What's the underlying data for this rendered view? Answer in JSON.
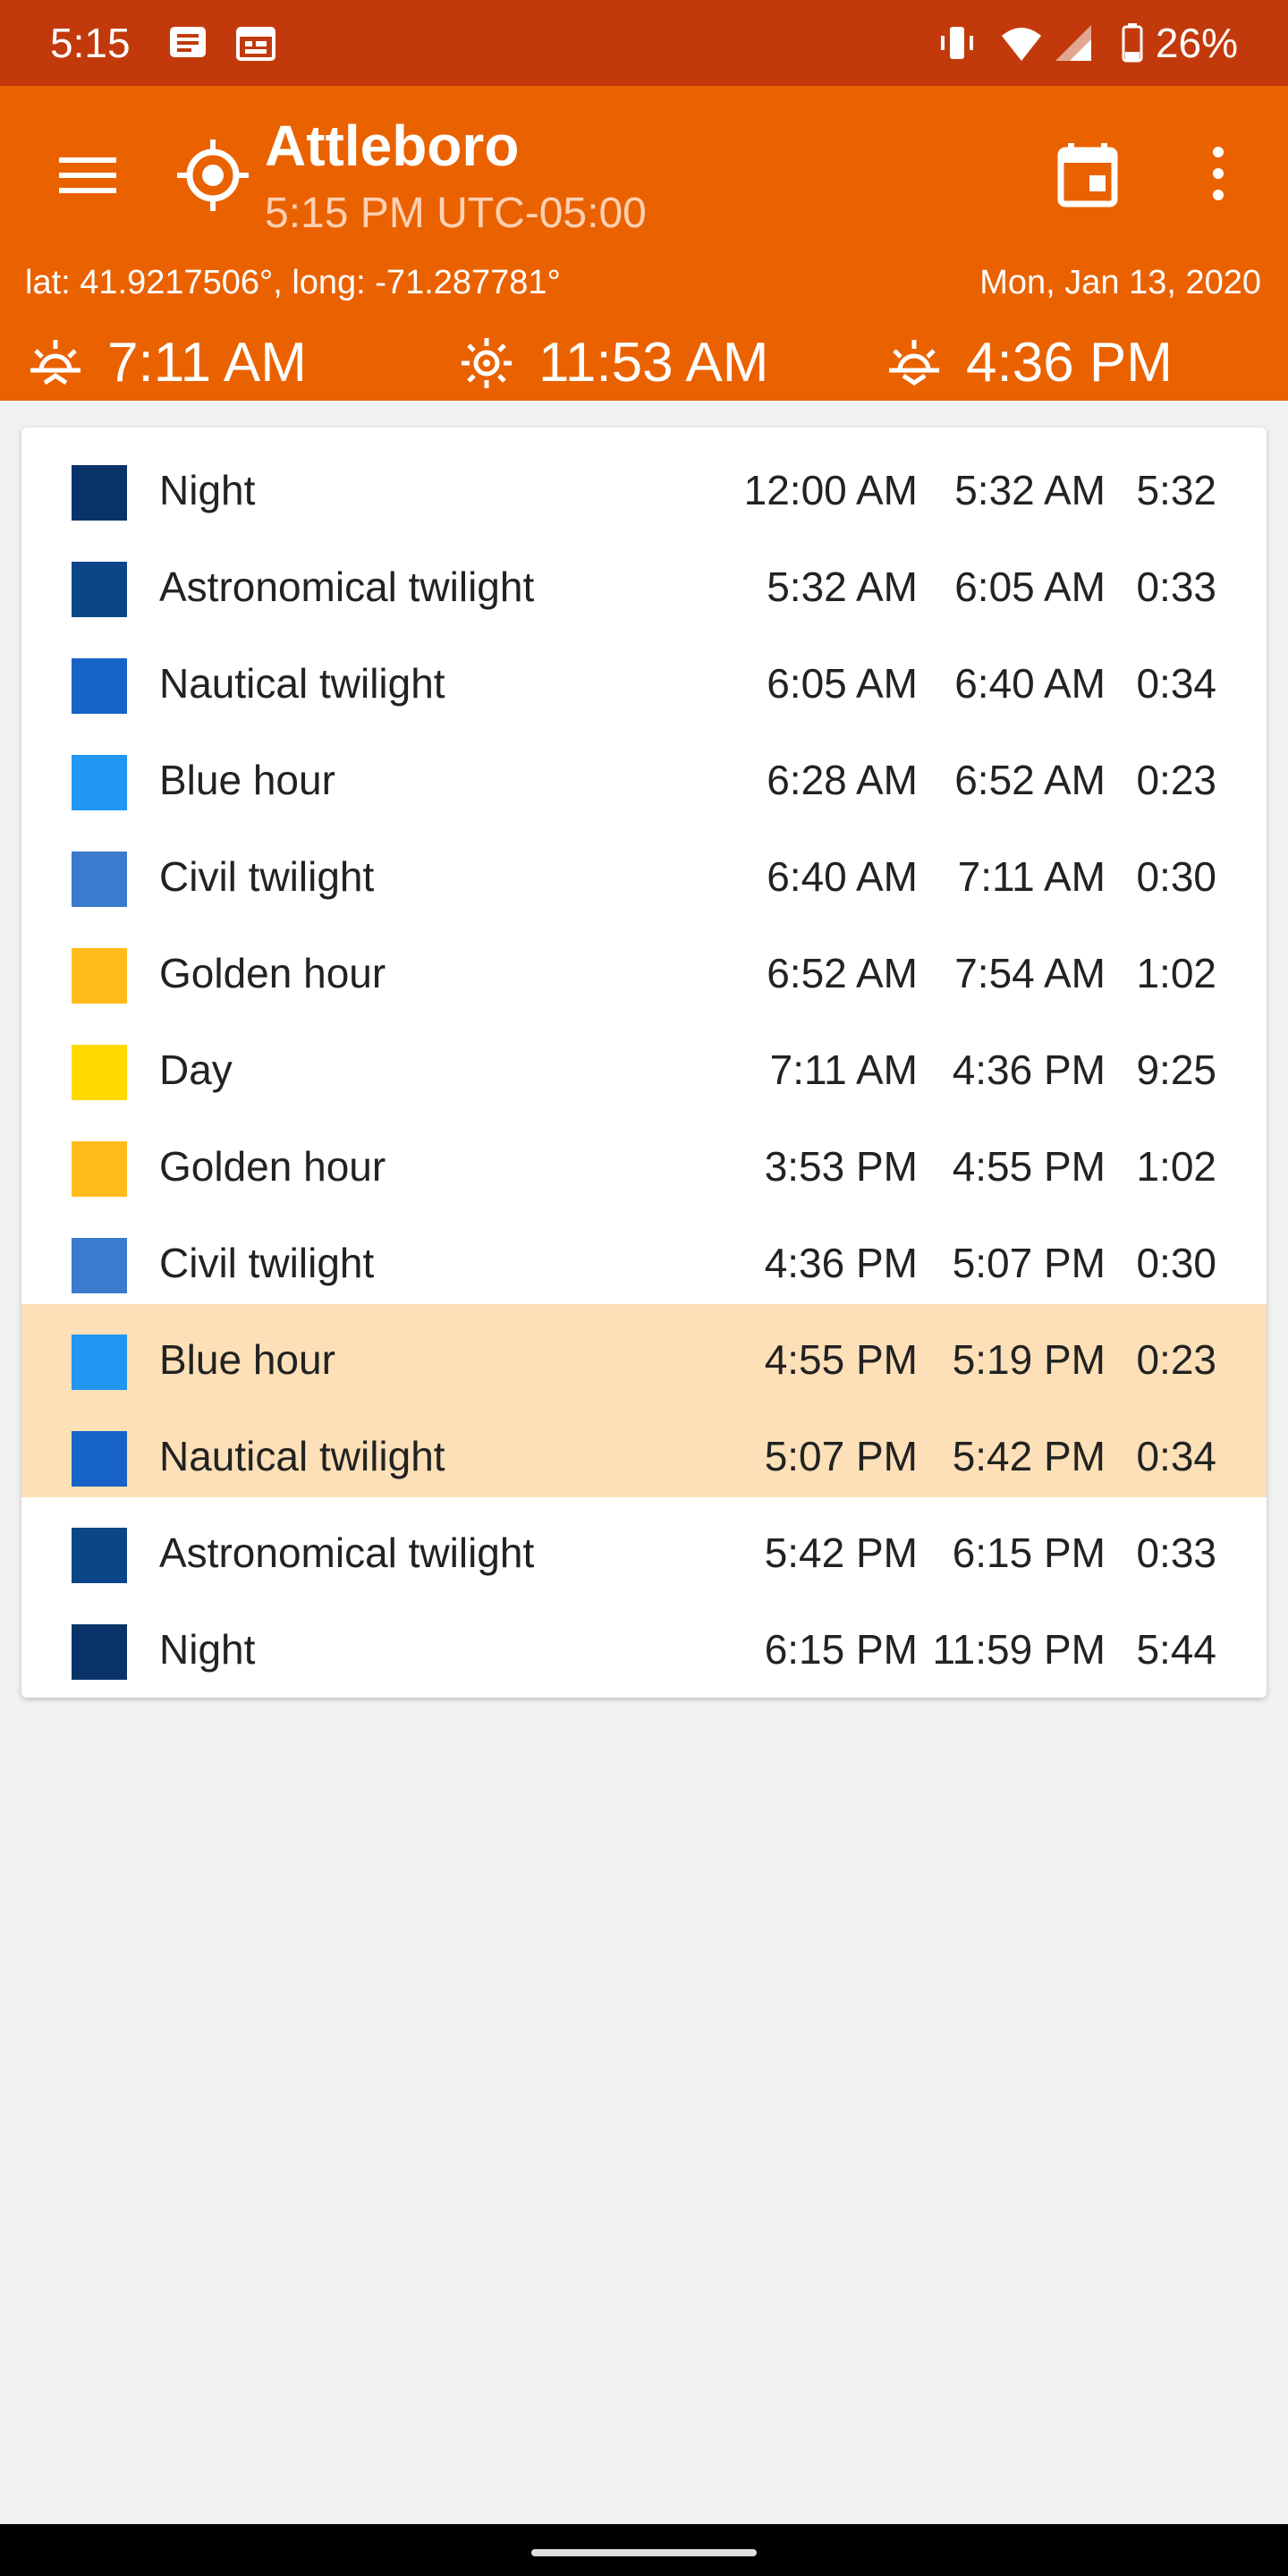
{
  "status_bar": {
    "time": "5:15",
    "battery": "26%",
    "left_icons": [
      "message-icon",
      "calendar-notification-icon"
    ],
    "right_icons": [
      "vibrate-icon",
      "wifi-icon",
      "signal-icon",
      "battery-icon"
    ]
  },
  "app_bar": {
    "title": "Attleboro",
    "subtitle": "5:15 PM UTC-05:00",
    "coordinates": "lat: 41.9217506°, long: -71.287781°",
    "date": "Mon, Jan 13, 2020",
    "sunrise": "7:11 AM",
    "noon": "11:53 AM",
    "sunset": "4:36 PM",
    "icons": [
      "menu-icon",
      "location-icon",
      "calendar-icon",
      "more-vert-icon"
    ]
  },
  "colors": {
    "status_bar": "#c23a0b",
    "app_bar": "#ea6200",
    "highlight": "#fde0b7",
    "night": "#0a3469",
    "astronomical": "#0d4688",
    "nautical": "#1763c7",
    "blue_hour": "#2196f3",
    "civil": "#3a7bcd",
    "golden": "#ffbb1c",
    "day": "#ffd900"
  },
  "rows": [
    {
      "label": "Night",
      "start": "12:00 AM",
      "end": "5:32 AM",
      "duration": "5:32",
      "color": "#0a3469",
      "highlighted": false
    },
    {
      "label": "Astronomical twilight",
      "start": "5:32 AM",
      "end": "6:05 AM",
      "duration": "0:33",
      "color": "#0d4688",
      "highlighted": false
    },
    {
      "label": "Nautical twilight",
      "start": "6:05 AM",
      "end": "6:40 AM",
      "duration": "0:34",
      "color": "#1763c7",
      "highlighted": false
    },
    {
      "label": "Blue hour",
      "start": "6:28 AM",
      "end": "6:52 AM",
      "duration": "0:23",
      "color": "#2196f3",
      "highlighted": false
    },
    {
      "label": "Civil twilight",
      "start": "6:40 AM",
      "end": "7:11 AM",
      "duration": "0:30",
      "color": "#3a7bcd",
      "highlighted": false
    },
    {
      "label": "Golden hour",
      "start": "6:52 AM",
      "end": "7:54 AM",
      "duration": "1:02",
      "color": "#ffbb1c",
      "highlighted": false
    },
    {
      "label": "Day",
      "start": "7:11 AM",
      "end": "4:36 PM",
      "duration": "9:25",
      "color": "#ffd900",
      "highlighted": false
    },
    {
      "label": "Golden hour",
      "start": "3:53 PM",
      "end": "4:55 PM",
      "duration": "1:02",
      "color": "#ffbb1c",
      "highlighted": false
    },
    {
      "label": "Civil twilight",
      "start": "4:36 PM",
      "end": "5:07 PM",
      "duration": "0:30",
      "color": "#3a7bcd",
      "highlighted": false
    },
    {
      "label": "Blue hour",
      "start": "4:55 PM",
      "end": "5:19 PM",
      "duration": "0:23",
      "color": "#2196f3",
      "highlighted": true
    },
    {
      "label": "Nautical twilight",
      "start": "5:07 PM",
      "end": "5:42 PM",
      "duration": "0:34",
      "color": "#1763c7",
      "highlighted": true
    },
    {
      "label": "Astronomical twilight",
      "start": "5:42 PM",
      "end": "6:15 PM",
      "duration": "0:33",
      "color": "#0d4688",
      "highlighted": false
    },
    {
      "label": "Night",
      "start": "6:15 PM",
      "end": "11:59 PM",
      "duration": "5:44",
      "color": "#0a3469",
      "highlighted": false
    }
  ]
}
